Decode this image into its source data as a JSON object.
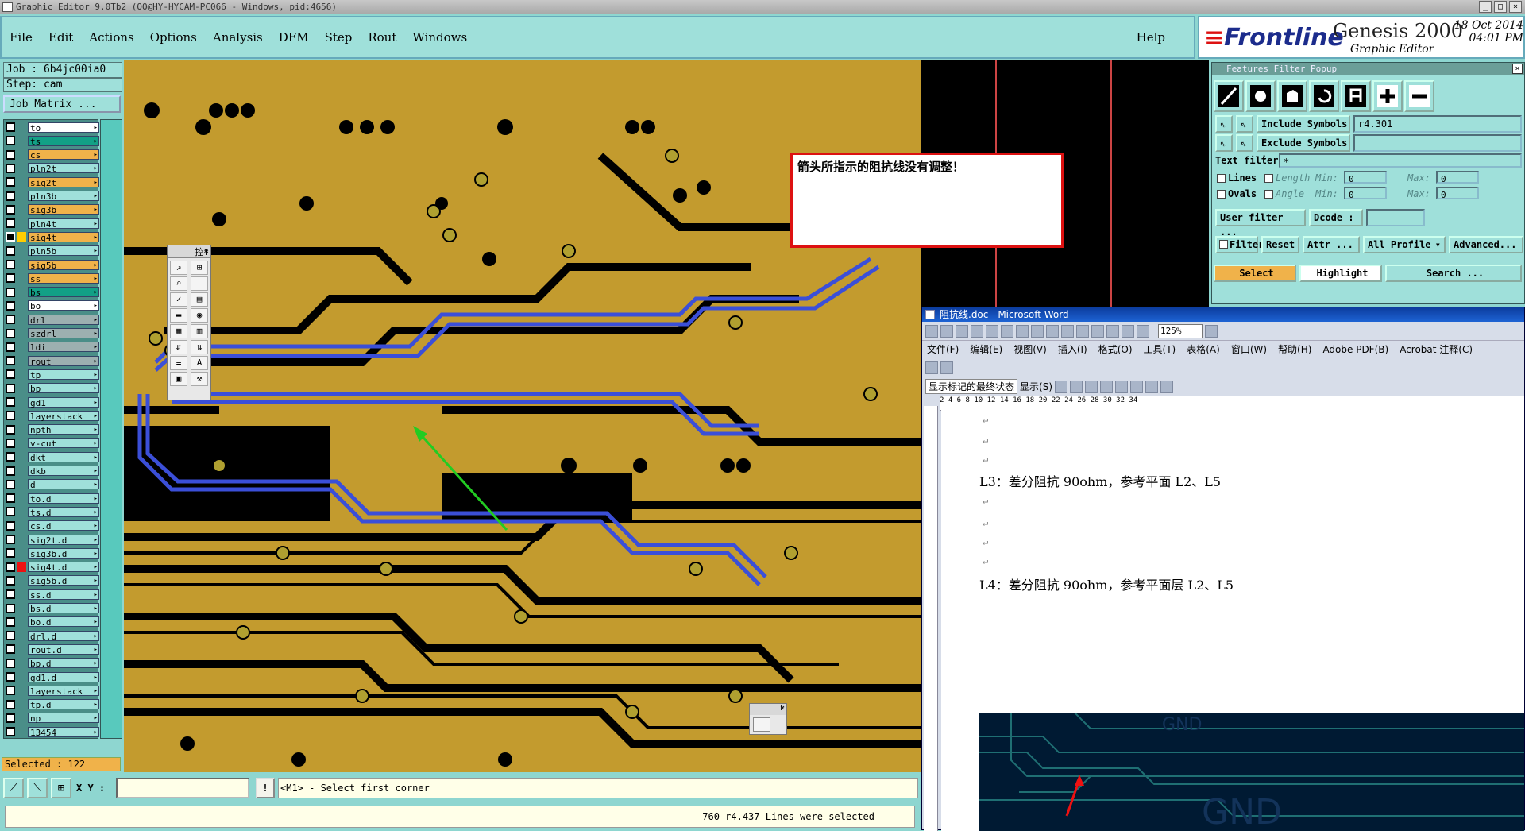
{
  "window": {
    "title": "Graphic Editor 9.0Tb2 (OO@HY-HYCAM-PC066 - Windows, pid:4656)",
    "controls": [
      "_",
      "□",
      "×"
    ]
  },
  "menu": {
    "items": [
      "File",
      "Edit",
      "Actions",
      "Options",
      "Analysis",
      "DFM",
      "Step",
      "Rout",
      "Windows"
    ],
    "help": "Help"
  },
  "brand": {
    "name": "Frontline",
    "product": "Genesis 2000",
    "subtitle": "Graphic Editor",
    "date": "18 Oct 2014",
    "time": "04:01 PM"
  },
  "job": {
    "label": "Job : 6b4jc00ia0",
    "step": "Step: cam",
    "matrix_button": "Job Matrix ..."
  },
  "layers": [
    {
      "name": "to",
      "color": "#ffffff"
    },
    {
      "name": "ts",
      "color": "#12a086"
    },
    {
      "name": "cs",
      "color": "#f0b24a"
    },
    {
      "name": "pln2t",
      "color": "#9fe0da"
    },
    {
      "name": "sig2t",
      "color": "#f0b24a"
    },
    {
      "name": "pln3b",
      "color": "#9fe0da"
    },
    {
      "name": "sig3b",
      "color": "#f0b24a"
    },
    {
      "name": "pln4t",
      "color": "#9fe0da"
    },
    {
      "name": "sig4t",
      "color": "#f0b24a",
      "active": true
    },
    {
      "name": "pln5b",
      "color": "#9fe0da"
    },
    {
      "name": "sig5b",
      "color": "#f0b24a"
    },
    {
      "name": "ss",
      "color": "#f0b24a"
    },
    {
      "name": "bs",
      "color": "#12a086"
    },
    {
      "name": "bo",
      "color": "#ffffff"
    },
    {
      "name": "drl",
      "color": "#9cb0b0"
    },
    {
      "name": "szdrl",
      "color": "#9cb0b0"
    },
    {
      "name": "ldi",
      "color": "#9cb0b0"
    },
    {
      "name": "rout",
      "color": "#9cb0b0"
    },
    {
      "name": "tp",
      "color": "#9fe0da"
    },
    {
      "name": "bp",
      "color": "#9fe0da"
    },
    {
      "name": "gd1",
      "color": "#9fe0da"
    },
    {
      "name": "layerstack",
      "color": "#9fe0da"
    },
    {
      "name": "npth",
      "color": "#9fe0da"
    },
    {
      "name": "v-cut",
      "color": "#9fe0da"
    },
    {
      "name": "dkt",
      "color": "#9fe0da"
    },
    {
      "name": "dkb",
      "color": "#9fe0da"
    },
    {
      "name": "d",
      "color": "#9fe0da"
    },
    {
      "name": "to.d",
      "color": "#9fe0da"
    },
    {
      "name": "ts.d",
      "color": "#9fe0da"
    },
    {
      "name": "cs.d",
      "color": "#9fe0da"
    },
    {
      "name": "sig2t.d",
      "color": "#9fe0da"
    },
    {
      "name": "sig3b.d",
      "color": "#9fe0da"
    },
    {
      "name": "sig4t.d",
      "color": "#9fe0da",
      "marker": "#ee1111"
    },
    {
      "name": "sig5b.d",
      "color": "#9fe0da"
    },
    {
      "name": "ss.d",
      "color": "#9fe0da"
    },
    {
      "name": "bs.d",
      "color": "#9fe0da"
    },
    {
      "name": "bo.d",
      "color": "#9fe0da"
    },
    {
      "name": "drl.d",
      "color": "#9fe0da"
    },
    {
      "name": "rout.d",
      "color": "#9fe0da"
    },
    {
      "name": "bp.d",
      "color": "#9fe0da"
    },
    {
      "name": "gd1.d",
      "color": "#9fe0da"
    },
    {
      "name": "layerstack",
      "color": "#9fe0da"
    },
    {
      "name": "tp.d",
      "color": "#9fe0da"
    },
    {
      "name": "np",
      "color": "#9fe0da"
    },
    {
      "name": "13454",
      "color": "#9fe0da"
    }
  ],
  "selected": "Selected : 122",
  "annotation": "箭头所指示的阻抗线没有调整！",
  "float_toolbar": {
    "title": "控f",
    "title2": "F"
  },
  "bottom": {
    "xy_label": "X Y :",
    "xy_value": "",
    "prompt_btn": "!",
    "prompt": "<M1> - Select first corner",
    "status": "760 r4.437 Lines were selected"
  },
  "features_filter": {
    "title": "Features Filter Popup",
    "include_label": "Include Symbols :",
    "include_value": "r4.301",
    "exclude_label": "Exclude Symbols :",
    "exclude_value": "",
    "text_filter_label": "Text filter",
    "text_filter_value": "*",
    "lines": "Lines",
    "ovals": "Ovals",
    "length": "Length",
    "angle": "Angle",
    "min": "Min:",
    "max": "Max:",
    "min_len": "0",
    "max_len": "0",
    "min_ang": "0",
    "max_ang": "0",
    "user_filter": "User filter ...",
    "dcode_label": "Dcode :",
    "dcode_value": "",
    "filter": "Filter",
    "reset": "Reset",
    "attr": "Attr ...",
    "all_profile": "All Profile",
    "advanced": "Advanced...",
    "select": "Select",
    "highlight": "Highlight",
    "search": "Search ..."
  },
  "word": {
    "title": "阻抗线.doc - Microsoft Word",
    "menu": [
      "文件(F)",
      "编辑(E)",
      "视图(V)",
      "插入(I)",
      "格式(O)",
      "工具(T)",
      "表格(A)",
      "窗口(W)",
      "帮助(H)",
      "Adobe PDF(B)",
      "Acrobat 注释(C)"
    ],
    "zoom": "125%",
    "markup_mode": "显示标记的最终状态",
    "show": "显示(S)",
    "line_l3": "L3：差分阻抗 90ohm，参考平面 L2、L5",
    "line_l4": "L4：差分阻抗 90ohm，参考平面层 L2、L5",
    "ruler": "2 4 6 8 10 12 14 16 18 20 22 24 26 28 30 32 34",
    "image_gnd": "GND"
  },
  "colors": {
    "board": "#c39b2e",
    "copper": "#000000",
    "trace_blue": "#3b4fd8",
    "pad": "#b0a030",
    "accent_red": "#dd1111",
    "arrow_green": "#22cc22"
  }
}
